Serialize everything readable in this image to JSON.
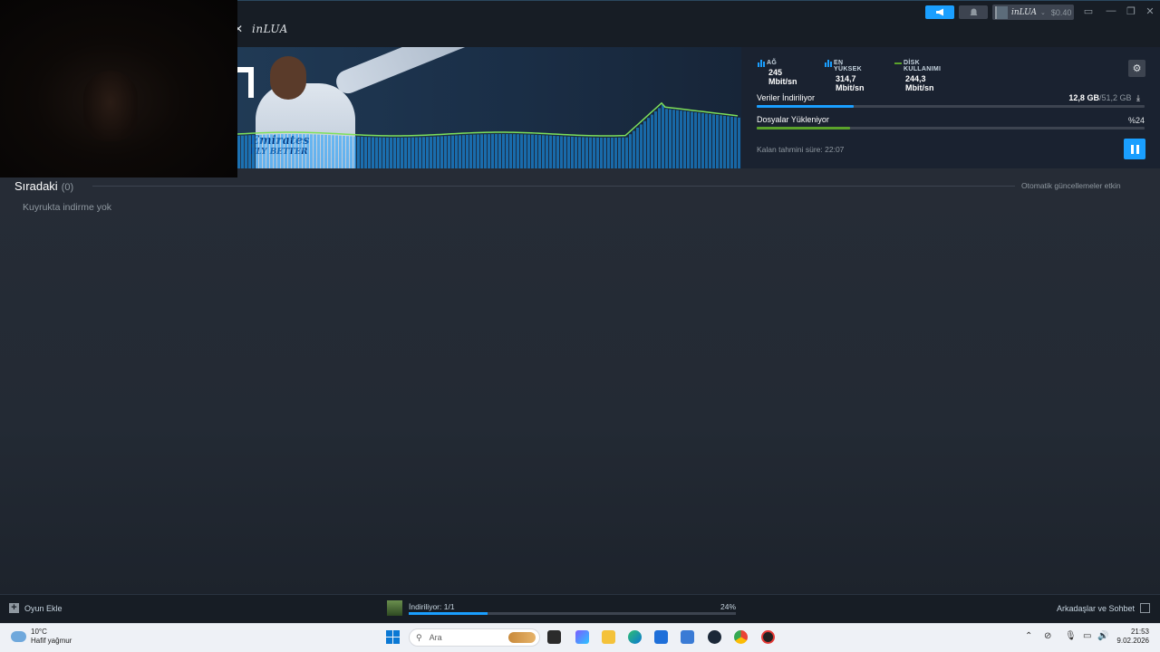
{
  "app": {
    "title": "inLUA",
    "close_glyph": "✕"
  },
  "header": {
    "account_name": "inLUA",
    "account_balance": "$0.40",
    "announce_icon": "megaphone-icon",
    "bell_icon": "bell-icon",
    "accent": "#1a9fff"
  },
  "download": {
    "stats": [
      {
        "label": "AĞ",
        "value": "245 Mbit/sn",
        "color": "#1a9fff"
      },
      {
        "label": "EN YÜKSEK",
        "value": "314,7 Mbit/sn",
        "color": "#1a9fff"
      },
      {
        "label": "DİSK KULLANIMI",
        "value": "244,3 Mbit/sn",
        "color": "#5ba32b"
      }
    ],
    "progress1": {
      "label": "Veriler İndiriliyor",
      "done": "12,8 GB",
      "total": "51,2 GB",
      "fraction": 0.25,
      "color": "#1a9fff"
    },
    "progress2": {
      "label": "Dosyalar Yükleniyor",
      "value": "%24",
      "fraction": 0.24,
      "color": "#5ba32b"
    },
    "eta_label": "Kalan tahmini süre: 22:07",
    "hero_text_line1": "Emirates",
    "hero_text_line2": "FLY BETTER"
  },
  "queue": {
    "title": "Sıradaki",
    "count": "(0)",
    "auto_updates": "Otomatik güncellemeler etkin",
    "empty": "Kuyrukta indirme yok"
  },
  "bottombar": {
    "add_game": "Oyun Ekle",
    "download_status": "İndiriliyor: 1/1",
    "download_pct": "24%",
    "download_fraction": 0.24,
    "friends": "Arkadaşlar ve Sohbet"
  },
  "taskbar": {
    "temperature": "10°C",
    "weather": "Hafif yağmur",
    "search_placeholder": "Ara",
    "time": "21:53",
    "date": "9.02.2026"
  }
}
